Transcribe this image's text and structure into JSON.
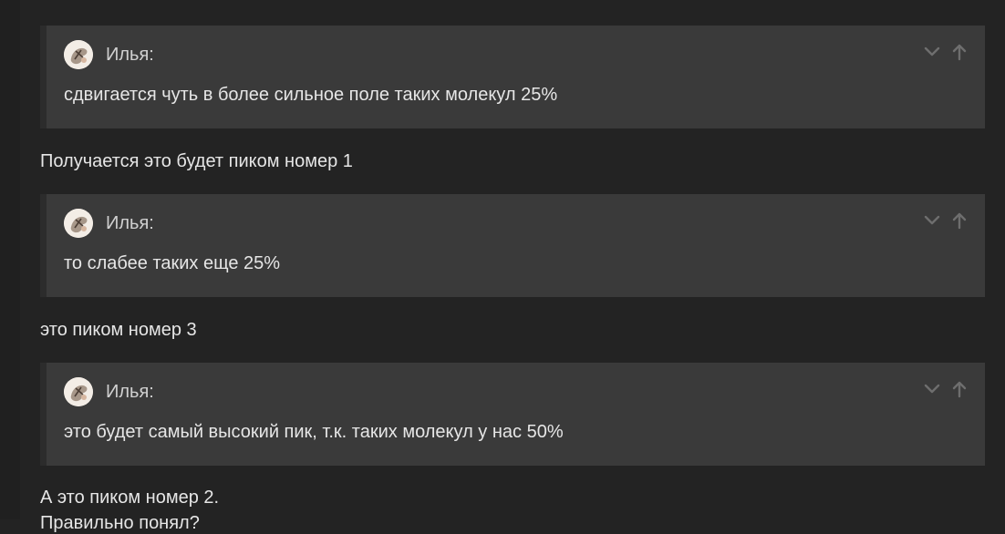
{
  "messages": [
    {
      "type": "quote",
      "author": "Илья:",
      "text": "сдвигается чуть в более сильное поле таких молекул 25%",
      "avatar_icon": "user-avatar-icon",
      "controls": [
        "chevron-down-icon",
        "arrow-up-icon"
      ]
    },
    {
      "type": "text",
      "text": "Получается это будет пиком номер 1"
    },
    {
      "type": "quote",
      "author": "Илья:",
      "text": "то слабее таких еще 25%",
      "avatar_icon": "user-avatar-icon",
      "controls": [
        "chevron-down-icon",
        "arrow-up-icon"
      ]
    },
    {
      "type": "text",
      "text": "это пиком номер 3"
    },
    {
      "type": "quote",
      "author": "Илья:",
      "text": "это будет самый высокий пик, т.к. таких молекул у нас 50%",
      "avatar_icon": "user-avatar-icon",
      "controls": [
        "chevron-down-icon",
        "arrow-up-icon"
      ]
    },
    {
      "type": "text",
      "text": "А это пиком номер 2."
    },
    {
      "type": "text",
      "text": "Правильно понял?"
    }
  ],
  "colors": {
    "background": "#232323",
    "quote_background": "#3a3a3a",
    "quote_border": "#2c2c2c",
    "text": "#e6e6e6",
    "muted_icon": "#6e6e6e"
  }
}
